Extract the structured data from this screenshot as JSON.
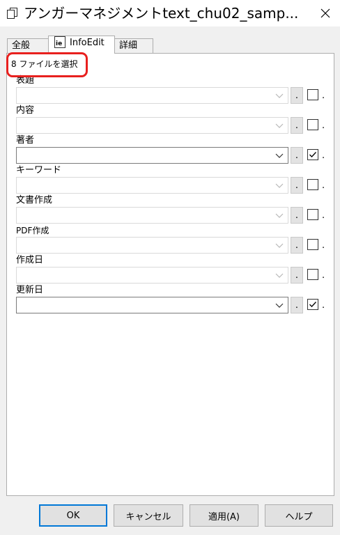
{
  "window": {
    "title": "アンガーマネジメントtext_chu02_samp...",
    "close_icon": "close-icon",
    "app_icon": "documents-icon"
  },
  "tabs": [
    {
      "label": "全般",
      "active": false
    },
    {
      "label": "InfoEdit",
      "active": true,
      "icon": "infoedit-icon"
    },
    {
      "label": "詳細",
      "active": false
    }
  ],
  "selection": {
    "text": "8 ファイルを選択"
  },
  "fields": [
    {
      "label": "表題",
      "value": "",
      "checked": false,
      "button": ".",
      "dot": "."
    },
    {
      "label": "内容",
      "value": "",
      "checked": false,
      "button": ".",
      "dot": "."
    },
    {
      "label": "著者",
      "value": "",
      "checked": true,
      "button": ".",
      "dot": "."
    },
    {
      "label": "キーワード",
      "value": "",
      "checked": false,
      "button": ".",
      "dot": "."
    },
    {
      "label": "文書作成",
      "value": "",
      "checked": false,
      "button": ".",
      "dot": "."
    },
    {
      "label": "PDF作成",
      "value": "",
      "checked": false,
      "button": ".",
      "dot": "."
    },
    {
      "label": "作成日",
      "value": "",
      "checked": false,
      "button": ".",
      "dot": "."
    },
    {
      "label": "更新日",
      "value": "",
      "checked": true,
      "button": ".",
      "dot": "."
    }
  ],
  "buttons": {
    "ok": "OK",
    "cancel": "キャンセル",
    "apply": "適用(A)",
    "help": "ヘルプ"
  },
  "colors": {
    "highlight": "#e8201e",
    "default_button_border": "#0078d7"
  }
}
